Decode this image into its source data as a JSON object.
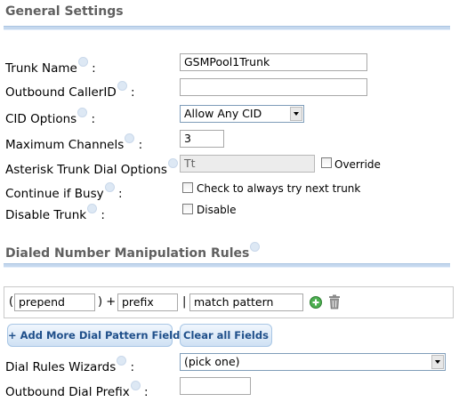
{
  "general": {
    "title": "General Settings",
    "fields": {
      "trunk_name": {
        "label": "Trunk Name",
        "suffix": ":",
        "value": "GSMPool1Trunk"
      },
      "outbound_callerid": {
        "label": "Outbound CallerID",
        "suffix": ":",
        "value": ""
      },
      "cid_options": {
        "label": "CID Options",
        "suffix": ":",
        "selected": "Allow Any CID"
      },
      "max_channels": {
        "label": "Maximum Channels",
        "suffix": ":",
        "value": "3"
      },
      "dial_options": {
        "label": "Asterisk Trunk Dial Options",
        "value": "Tt",
        "override_label": "Override"
      },
      "continue_busy": {
        "label": "Continue if Busy",
        "suffix": ":",
        "checkbox_label": "Check to always try next trunk"
      },
      "disable_trunk": {
        "label": "Disable Trunk",
        "suffix": ":",
        "checkbox_label": "Disable"
      }
    }
  },
  "dialed": {
    "title": "Dialed Number Manipulation Rules",
    "pattern": {
      "open_paren": "(",
      "close_paren_plus": ") +",
      "pipe": "|",
      "prepend": "prepend",
      "prefix": "prefix",
      "match": "match pattern"
    },
    "buttons": {
      "add_more": "+ Add More Dial Pattern Fields",
      "clear_all": "Clear all Fields"
    },
    "wizard": {
      "label": "Dial Rules Wizards",
      "suffix": ":",
      "selected": "(pick one)"
    },
    "outbound_prefix": {
      "label": "Outbound Dial Prefix",
      "suffix": ":",
      "value": ""
    }
  },
  "colors": {
    "accent_rule": "#c5d8ee",
    "button_text": "#1f4f8a",
    "add_icon": "#4caf50"
  }
}
